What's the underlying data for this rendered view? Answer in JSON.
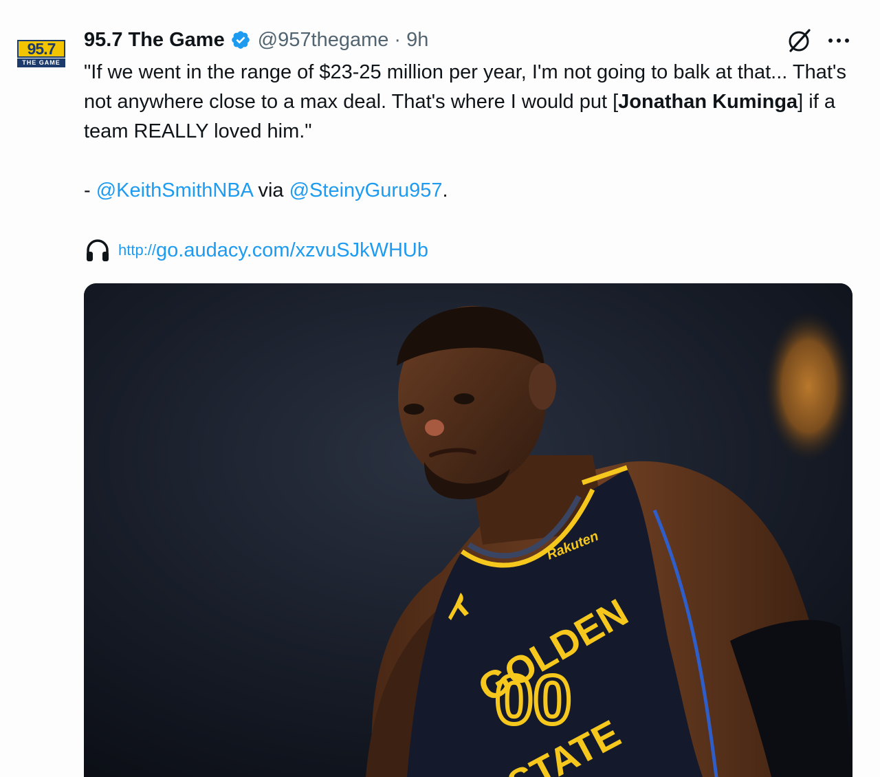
{
  "account": {
    "avatar_number": "95.7",
    "avatar_subtitle": "THE GAME",
    "display_name": "95.7 The Game",
    "handle": "@957thegame",
    "separator": "·",
    "time": "9h",
    "verified_color": "#1d9bf0"
  },
  "tweet": {
    "quote_part1": "\"If we went in the range of $23-25 million per year, I'm not going to balk at that... That's not anywhere close to a max deal. That's where I would put [",
    "quote_bold": "Jonathan Kuminga",
    "quote_part2": "] if a team REALLY loved him.\"",
    "credit_prefix": "- ",
    "credit_mention1": "@KeithSmithNBA",
    "credit_via": " via ",
    "credit_mention2": "@SteinyGuru957",
    "credit_suffix": ".",
    "link_prefix": "http://",
    "link_text": "go.audacy.com/xzvuSJkWHUb"
  },
  "icons": {
    "grok": "grok-icon",
    "more": "more-icon",
    "verified": "verified-badge-icon",
    "headphones": "headphones-icon"
  },
  "media": {
    "jersey_sponsor": "Rakuten",
    "jersey_team_top": "GOLDEN",
    "jersey_number": "00",
    "jersey_team_bottom": "STATE",
    "jersey_color": "#141a2b",
    "lettering_color": "#f6c81e"
  }
}
